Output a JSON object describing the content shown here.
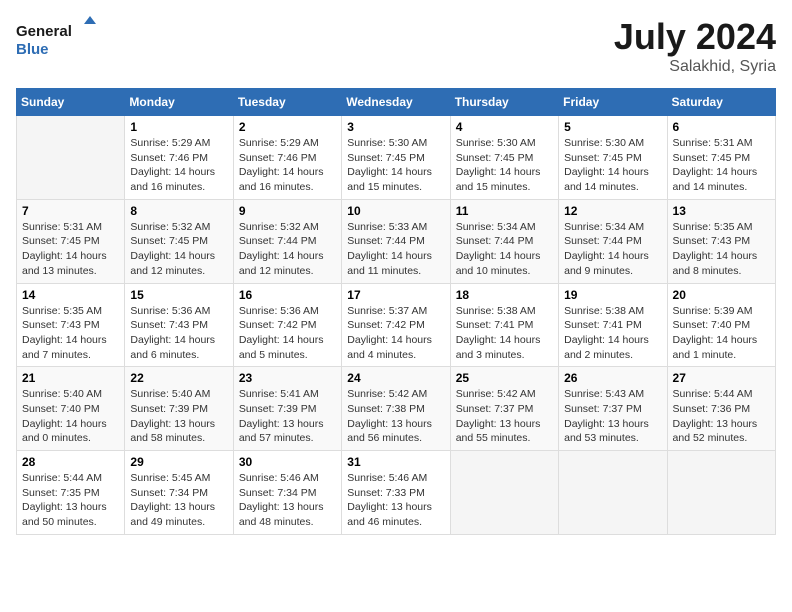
{
  "header": {
    "logo_line1": "General",
    "logo_line2": "Blue",
    "month_title": "July 2024",
    "location": "Salakhid, Syria"
  },
  "weekdays": [
    "Sunday",
    "Monday",
    "Tuesday",
    "Wednesday",
    "Thursday",
    "Friday",
    "Saturday"
  ],
  "weeks": [
    [
      {
        "day": "",
        "info": ""
      },
      {
        "day": "1",
        "info": "Sunrise: 5:29 AM\nSunset: 7:46 PM\nDaylight: 14 hours\nand 16 minutes."
      },
      {
        "day": "2",
        "info": "Sunrise: 5:29 AM\nSunset: 7:46 PM\nDaylight: 14 hours\nand 16 minutes."
      },
      {
        "day": "3",
        "info": "Sunrise: 5:30 AM\nSunset: 7:45 PM\nDaylight: 14 hours\nand 15 minutes."
      },
      {
        "day": "4",
        "info": "Sunrise: 5:30 AM\nSunset: 7:45 PM\nDaylight: 14 hours\nand 15 minutes."
      },
      {
        "day": "5",
        "info": "Sunrise: 5:30 AM\nSunset: 7:45 PM\nDaylight: 14 hours\nand 14 minutes."
      },
      {
        "day": "6",
        "info": "Sunrise: 5:31 AM\nSunset: 7:45 PM\nDaylight: 14 hours\nand 14 minutes."
      }
    ],
    [
      {
        "day": "7",
        "info": "Sunrise: 5:31 AM\nSunset: 7:45 PM\nDaylight: 14 hours\nand 13 minutes."
      },
      {
        "day": "8",
        "info": "Sunrise: 5:32 AM\nSunset: 7:45 PM\nDaylight: 14 hours\nand 12 minutes."
      },
      {
        "day": "9",
        "info": "Sunrise: 5:32 AM\nSunset: 7:44 PM\nDaylight: 14 hours\nand 12 minutes."
      },
      {
        "day": "10",
        "info": "Sunrise: 5:33 AM\nSunset: 7:44 PM\nDaylight: 14 hours\nand 11 minutes."
      },
      {
        "day": "11",
        "info": "Sunrise: 5:34 AM\nSunset: 7:44 PM\nDaylight: 14 hours\nand 10 minutes."
      },
      {
        "day": "12",
        "info": "Sunrise: 5:34 AM\nSunset: 7:44 PM\nDaylight: 14 hours\nand 9 minutes."
      },
      {
        "day": "13",
        "info": "Sunrise: 5:35 AM\nSunset: 7:43 PM\nDaylight: 14 hours\nand 8 minutes."
      }
    ],
    [
      {
        "day": "14",
        "info": "Sunrise: 5:35 AM\nSunset: 7:43 PM\nDaylight: 14 hours\nand 7 minutes."
      },
      {
        "day": "15",
        "info": "Sunrise: 5:36 AM\nSunset: 7:43 PM\nDaylight: 14 hours\nand 6 minutes."
      },
      {
        "day": "16",
        "info": "Sunrise: 5:36 AM\nSunset: 7:42 PM\nDaylight: 14 hours\nand 5 minutes."
      },
      {
        "day": "17",
        "info": "Sunrise: 5:37 AM\nSunset: 7:42 PM\nDaylight: 14 hours\nand 4 minutes."
      },
      {
        "day": "18",
        "info": "Sunrise: 5:38 AM\nSunset: 7:41 PM\nDaylight: 14 hours\nand 3 minutes."
      },
      {
        "day": "19",
        "info": "Sunrise: 5:38 AM\nSunset: 7:41 PM\nDaylight: 14 hours\nand 2 minutes."
      },
      {
        "day": "20",
        "info": "Sunrise: 5:39 AM\nSunset: 7:40 PM\nDaylight: 14 hours\nand 1 minute."
      }
    ],
    [
      {
        "day": "21",
        "info": "Sunrise: 5:40 AM\nSunset: 7:40 PM\nDaylight: 14 hours\nand 0 minutes."
      },
      {
        "day": "22",
        "info": "Sunrise: 5:40 AM\nSunset: 7:39 PM\nDaylight: 13 hours\nand 58 minutes."
      },
      {
        "day": "23",
        "info": "Sunrise: 5:41 AM\nSunset: 7:39 PM\nDaylight: 13 hours\nand 57 minutes."
      },
      {
        "day": "24",
        "info": "Sunrise: 5:42 AM\nSunset: 7:38 PM\nDaylight: 13 hours\nand 56 minutes."
      },
      {
        "day": "25",
        "info": "Sunrise: 5:42 AM\nSunset: 7:37 PM\nDaylight: 13 hours\nand 55 minutes."
      },
      {
        "day": "26",
        "info": "Sunrise: 5:43 AM\nSunset: 7:37 PM\nDaylight: 13 hours\nand 53 minutes."
      },
      {
        "day": "27",
        "info": "Sunrise: 5:44 AM\nSunset: 7:36 PM\nDaylight: 13 hours\nand 52 minutes."
      }
    ],
    [
      {
        "day": "28",
        "info": "Sunrise: 5:44 AM\nSunset: 7:35 PM\nDaylight: 13 hours\nand 50 minutes."
      },
      {
        "day": "29",
        "info": "Sunrise: 5:45 AM\nSunset: 7:34 PM\nDaylight: 13 hours\nand 49 minutes."
      },
      {
        "day": "30",
        "info": "Sunrise: 5:46 AM\nSunset: 7:34 PM\nDaylight: 13 hours\nand 48 minutes."
      },
      {
        "day": "31",
        "info": "Sunrise: 5:46 AM\nSunset: 7:33 PM\nDaylight: 13 hours\nand 46 minutes."
      },
      {
        "day": "",
        "info": ""
      },
      {
        "day": "",
        "info": ""
      },
      {
        "day": "",
        "info": ""
      }
    ]
  ]
}
